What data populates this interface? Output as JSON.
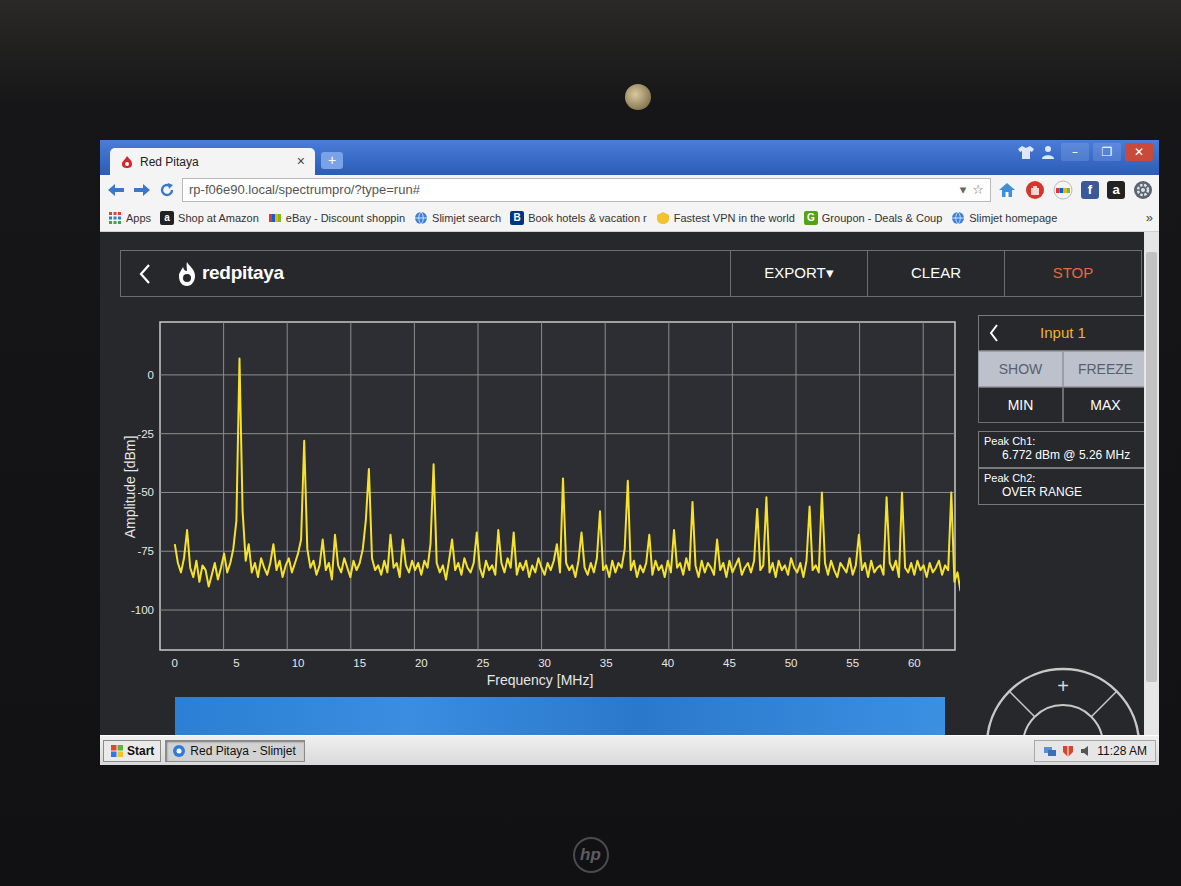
{
  "browser": {
    "tab": {
      "title": "Red Pitaya",
      "close": "×",
      "selected": true
    },
    "new_tab": "+",
    "window_controls": [
      "–",
      "❐",
      "✕"
    ],
    "url": "rp-f06e90.local/spectrumpro/?type=run#",
    "url_dropdown": "▾",
    "star": "☆",
    "extensions": [
      {
        "kind": "home"
      },
      {
        "kind": "hand"
      },
      {
        "kind": "ebay"
      },
      {
        "kind": "letter",
        "glyph": "f",
        "color": "#3b5998"
      },
      {
        "kind": "letter",
        "glyph": "a",
        "color": "#222222"
      },
      {
        "kind": "gear"
      }
    ],
    "bookmarks": [
      {
        "label": "Apps",
        "kind": "apps"
      },
      {
        "label": "Shop at Amazon",
        "kind": "letter",
        "glyph": "a",
        "color": "#222222"
      },
      {
        "label": "eBay - Discount shoppin",
        "kind": "ebay"
      },
      {
        "label": "Slimjet search",
        "kind": "globe"
      },
      {
        "label": "Book hotels & vacation r",
        "kind": "letter",
        "glyph": "B",
        "color": "#003580"
      },
      {
        "label": "Fastest VPN in the world",
        "kind": "vpn"
      },
      {
        "label": "Groupon - Deals & Coup",
        "kind": "letter",
        "glyph": "G",
        "color": "#53a318"
      },
      {
        "label": "Slimjet homepage",
        "kind": "globe"
      }
    ],
    "bookmarks_more": "»"
  },
  "app": {
    "logo": "redpitaya",
    "menu": [
      {
        "label": "EXPORT▾",
        "color": "#ffffff"
      },
      {
        "label": "CLEAR",
        "color": "#ffffff"
      },
      {
        "label": "STOP",
        "color": "#e8683f"
      }
    ],
    "input_panel": {
      "title": "Input 1",
      "buttons": [
        {
          "label": "SHOW",
          "selected": true
        },
        {
          "label": "FREEZE",
          "selected": true
        },
        {
          "label": "MIN",
          "selected": false
        },
        {
          "label": "MAX",
          "selected": false
        }
      ],
      "peaks": [
        {
          "label": "Peak Ch1:",
          "value": "6.772 dBm @ 5.26 MHz"
        },
        {
          "label": "Peak Ch2:",
          "value": "OVER RANGE"
        }
      ]
    },
    "nav_wheel": {
      "zoom_in": "+"
    },
    "chart": {
      "y_title": "Amplitude [dBm]",
      "x_title": "Frequency [MHz]",
      "y_ticks": [
        "0",
        "-25",
        "-50",
        "-75",
        "-100"
      ],
      "x_ticks": [
        "0",
        "5",
        "10",
        "15",
        "20",
        "25",
        "30",
        "35",
        "40",
        "45",
        "50",
        "55",
        "60"
      ],
      "series": [
        {
          "freq_start_mhz": 0,
          "freq_step_mhz": 0.25,
          "values": [
            -72,
            -80,
            -84,
            -78,
            -66,
            -82,
            -86,
            -79,
            -88,
            -81,
            -83,
            -90,
            -85,
            -80,
            -87,
            -82,
            -76,
            -84,
            -80,
            -74,
            -62,
            7,
            -58,
            -79,
            -72,
            -84,
            -80,
            -86,
            -78,
            -82,
            -85,
            -80,
            -72,
            -83,
            -79,
            -86,
            -81,
            -78,
            -84,
            -80,
            -76,
            -70,
            -28,
            -74,
            -82,
            -79,
            -85,
            -81,
            -70,
            -83,
            -80,
            -87,
            -68,
            -81,
            -84,
            -78,
            -82,
            -86,
            -79,
            -83,
            -80,
            -74,
            -62,
            -40,
            -78,
            -83,
            -81,
            -85,
            -79,
            -84,
            -68,
            -82,
            -80,
            -86,
            -70,
            -81,
            -84,
            -79,
            -83,
            -80,
            -85,
            -79,
            -82,
            -72,
            -38,
            -80,
            -84,
            -81,
            -87,
            -79,
            -70,
            -83,
            -80,
            -85,
            -78,
            -82,
            -84,
            -80,
            -67,
            -82,
            -86,
            -79,
            -83,
            -81,
            -85,
            -66,
            -80,
            -84,
            -78,
            -82,
            -67,
            -85,
            -80,
            -83,
            -79,
            -86,
            -81,
            -84,
            -78,
            -82,
            -85,
            -80,
            -83,
            -79,
            -72,
            -84,
            -44,
            -80,
            -83,
            -81,
            -86,
            -79,
            -67,
            -82,
            -85,
            -80,
            -84,
            -78,
            -58,
            -83,
            -81,
            -86,
            -79,
            -84,
            -80,
            -82,
            -74,
            -45,
            -83,
            -79,
            -86,
            -81,
            -84,
            -80,
            -68,
            -85,
            -79,
            -83,
            -81,
            -86,
            -79,
            -84,
            -66,
            -82,
            -80,
            -85,
            -78,
            -83,
            -54,
            -81,
            -86,
            -79,
            -84,
            -80,
            -82,
            -85,
            -70,
            -83,
            -80,
            -86,
            -79,
            -84,
            -81,
            -78,
            -85,
            -82,
            -80,
            -84,
            -79,
            -57,
            -83,
            -81,
            -52,
            -84,
            -80,
            -86,
            -79,
            -83,
            -81,
            -85,
            -78,
            -82,
            -84,
            -80,
            -86,
            -79,
            -56,
            -83,
            -81,
            -84,
            -50,
            -80,
            -85,
            -79,
            -83,
            -86,
            -80,
            -82,
            -84,
            -78,
            -85,
            -81,
            -68,
            -83,
            -80,
            -86,
            -79,
            -84,
            -82,
            -81,
            -85,
            -52,
            -80,
            -83,
            -79,
            -86,
            -50,
            -82,
            -84,
            -80,
            -85,
            -79,
            -83,
            -81,
            -86,
            -80,
            -84,
            -82,
            -79,
            -85,
            -81,
            -83,
            -50,
            -88,
            -84,
            -92
          ]
        }
      ]
    }
  },
  "taskbar": {
    "start": "Start",
    "tasks": [
      {
        "label": "Red Pitaya - Slimjet",
        "selected": true
      }
    ],
    "clock": "11:28 AM"
  },
  "device": {
    "brand": "hp"
  }
}
